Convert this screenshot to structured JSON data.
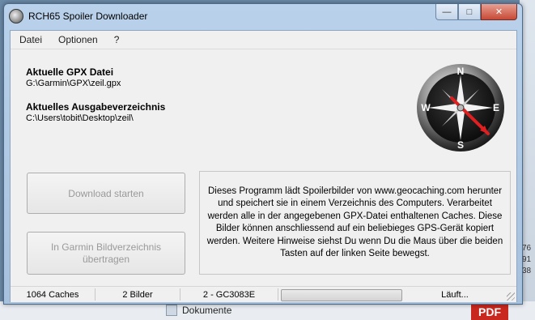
{
  "window": {
    "title": "RCH65 Spoiler Downloader",
    "minimize_glyph": "—",
    "maximize_glyph": "□",
    "close_glyph": "✕"
  },
  "menu": [
    "Datei",
    "Optionen",
    "?"
  ],
  "gpx": {
    "label": "Aktuelle GPX Datei",
    "path": "G:\\Garmin\\GPX\\zeil.gpx"
  },
  "output_dir": {
    "label": "Aktuelles Ausgabeverzeichnis",
    "path": "C:\\Users\\tobit\\Desktop\\zeil\\"
  },
  "compass": {
    "labels": [
      "N",
      "E",
      "S",
      "W"
    ]
  },
  "buttons": {
    "download": "Download starten",
    "transfer_line1": "In Garmin Bildverzeichnis",
    "transfer_line2": "übertragen"
  },
  "info_text": "Dieses Programm lädt Spoilerbilder von www.geocaching.com herunter und speichert sie in einem Verzeichnis des Computers. Verarbeitet werden alle in der angegebenen GPX-Datei enthaltenen Caches. Diese Bilder können anschliessend auf ein beliebieges GPS-Gerät kopiert werden. Weitere Hinweise siehst Du wenn Du die Maus über die beiden Tasten auf der linken Seite bewegst.",
  "status": {
    "caches": "1064 Caches",
    "images": "2 Bilder",
    "current": "2 - GC3083E",
    "progress": 0,
    "state": "Läuft..."
  },
  "background": {
    "doc_label": "Dokumente",
    "pdf_label": "PDF",
    "side_numbers": [
      "76",
      "91",
      "38"
    ]
  },
  "colors": {
    "title_bar": "#b9d1ea",
    "close_button": "#c74a36",
    "compass_arrow": "#e02020"
  }
}
